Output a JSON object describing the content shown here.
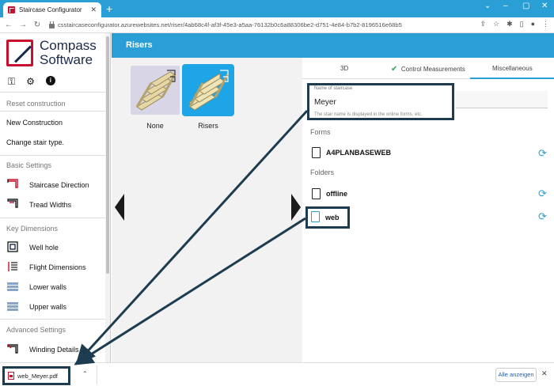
{
  "browser": {
    "tab_title": "Staircase Configurator",
    "tab_close": "✕",
    "new_tab": "+",
    "url": "csstaircaseconfigurator.azurewebsites.net/riser/4ab68c4f-af3f-45e3-a5aa-76132b0c6a88306be2-d751-4e84-b7b2-8196516e68b5",
    "window_controls": [
      "⌄",
      "–",
      "▢",
      "✕"
    ]
  },
  "sidebar": {
    "logo_line1": "Compass",
    "logo_line2": "Software",
    "tools": [
      "key-icon",
      "gear-icon",
      "info-icon"
    ],
    "plain_items": [
      "New Construction",
      "Change stair type."
    ],
    "reset": "Reset construction",
    "basic_settings": "Basic Settings",
    "basic_items": [
      "Staircase Direction",
      "Tread Widths"
    ],
    "key_dimensions": "Key Dimensions",
    "key_items": [
      "Well hole",
      "Flight Dimensions",
      "Lower walls",
      "Upper walls"
    ],
    "advanced_settings": "Advanced Settings",
    "advanced_items": [
      "Winding Details"
    ]
  },
  "header": {
    "title": "Risers"
  },
  "risers": {
    "options": [
      {
        "label": "None",
        "selected": false
      },
      {
        "label": "Risers",
        "selected": true
      }
    ]
  },
  "right": {
    "tabs": [
      "3D",
      "Control Measurements",
      "Miscellaneous"
    ],
    "active_tab": "Miscellaneous",
    "name_caption": "Name of staircase",
    "name_value": "Meyer",
    "name_hint": "The stair name is displayed in the online forms, etc.",
    "forms_label": "Forms",
    "forms": [
      "A4PLANBASEWEB"
    ],
    "folders_label": "Folders",
    "folders": [
      "offline",
      "web"
    ]
  },
  "downloads": {
    "file": "web_Meyer.pdf",
    "show_all": "Alle anzeigen",
    "close": "✕"
  },
  "colors": {
    "accent": "#2a9fd6",
    "annotation": "#1d3c4f",
    "brand_red": "#c8102e",
    "brand_navy": "#1b2a4a"
  }
}
